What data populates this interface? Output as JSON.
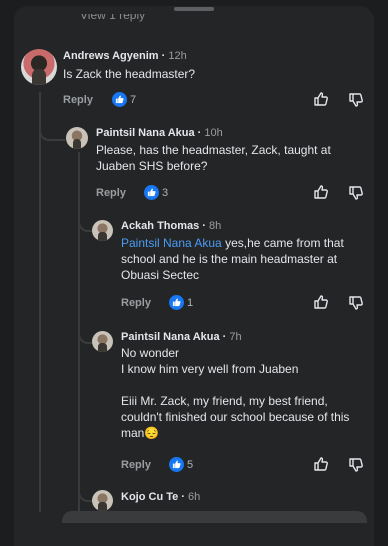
{
  "top_cut_text": "View 1 reply",
  "comments": [
    {
      "author": "Andrews Agyenim",
      "time": "12h",
      "text": "Is Zack the headmaster?",
      "reply_label": "Reply",
      "likes": "7"
    },
    {
      "author": "Paintsil Nana Akua",
      "time": "10h",
      "text": "Please, has the headmaster, Zack, taught at Juaben SHS before?",
      "reply_label": "Reply",
      "likes": "3"
    },
    {
      "author": "Ackah Thomas",
      "time": "8h",
      "mention": "Paintsil Nana Akua",
      "text": " yes,he came from that school and he is the main headmaster at Obuasi Sectec",
      "reply_label": "Reply",
      "likes": "1"
    },
    {
      "author": "Paintsil Nana Akua",
      "time": "7h",
      "line1": "No wonder",
      "line2": "I know him very well from Juaben",
      "line3": "Eiii Mr. Zack, my friend, my best friend, couldn't finished our school because of this man",
      "emoji": "😔",
      "reply_label": "Reply",
      "likes": "5"
    },
    {
      "author": "Kojo Cu Te",
      "time": "6h"
    }
  ]
}
